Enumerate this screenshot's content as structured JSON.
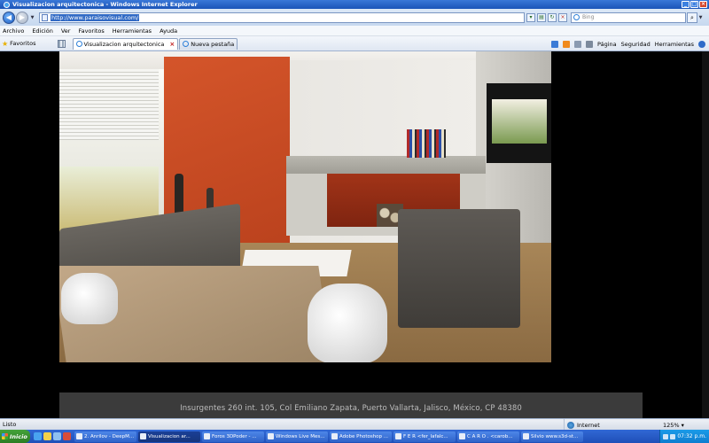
{
  "window": {
    "title": "Visualizacion arquitectonica - Windows Internet Explorer"
  },
  "address_bar": {
    "url": "http://www.paraisovisual.com/",
    "search_placeholder": "Bing"
  },
  "menu": [
    "Archivo",
    "Edición",
    "Ver",
    "Favoritos",
    "Herramientas",
    "Ayuda"
  ],
  "favorites_bar": {
    "favorites_label": "Favoritos",
    "tabs": [
      {
        "label": "Visualizacion arquitectonica",
        "active": true
      },
      {
        "label": "Nueva pestaña",
        "active": false
      }
    ],
    "commands": {
      "page": "Página",
      "security": "Seguridad",
      "tools": "Herramientas"
    }
  },
  "content": {
    "footer_address": "Insurgentes 260 int. 105, Col Emiliano Zapata, Puerto Vallarta, Jalisco, México,  CP 48380"
  },
  "status_bar": {
    "status": "Listo",
    "zone": "Internet",
    "zoom": "125%"
  },
  "taskbar": {
    "start": "Inicio",
    "tasks": [
      {
        "label": "2. Anrilov - DeepM...",
        "active": false
      },
      {
        "label": "Visualizacion ar...",
        "active": true
      },
      {
        "label": "Foros 3DPoder - ...",
        "active": false
      },
      {
        "label": "Windows Live Mes...",
        "active": false
      },
      {
        "label": "Adobe Photoshop ...",
        "active": false
      },
      {
        "label": "F E R  <fer_lafalc...",
        "active": false
      },
      {
        "label": "C A R O . <carob...",
        "active": false
      },
      {
        "label": "Silvio www.s3d-st...",
        "active": false
      }
    ],
    "clock": "07:32 p.m."
  }
}
